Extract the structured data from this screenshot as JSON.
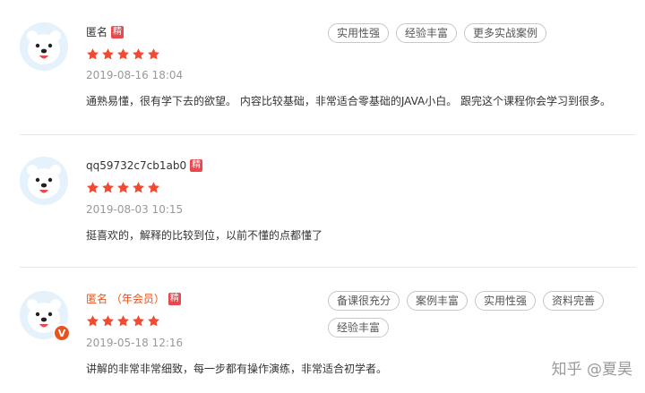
{
  "reviews": [
    {
      "username": "匿名",
      "badge": "精",
      "rating": 5,
      "time": "2019-08-16 18:04",
      "content": "通熟易懂，很有学下去的欲望。 内容比较基础，非常适合零基础的JAVA小白。 跟完这个课程你会学习到很多。",
      "tags": [
        "实用性强",
        "经验丰富",
        "更多实战案例"
      ]
    },
    {
      "username": "qq59732c7cb1ab0",
      "badge": "精",
      "rating": 5,
      "time": "2019-08-03 10:15",
      "content": "挺喜欢的，解释的比较到位，以前不懂的点都懂了",
      "tags": []
    },
    {
      "username": "匿名 （年会员）",
      "badge": "精",
      "rating": 5,
      "vip_badge": "V",
      "time": "2019-05-18 12:16",
      "content": "讲解的非常非常细致，每一步都有操作演练，非常适合初学者。",
      "tags": [
        "备课很充分",
        "案例丰富",
        "实用性强",
        "资料完善",
        "经验丰富"
      ]
    }
  ],
  "watermark": "知乎 @夏昊",
  "colors": {
    "star": "#f24a30",
    "badge": "#e8484e",
    "vip_name": "#e8531e",
    "avatar_bg": "#e6f2fb"
  }
}
